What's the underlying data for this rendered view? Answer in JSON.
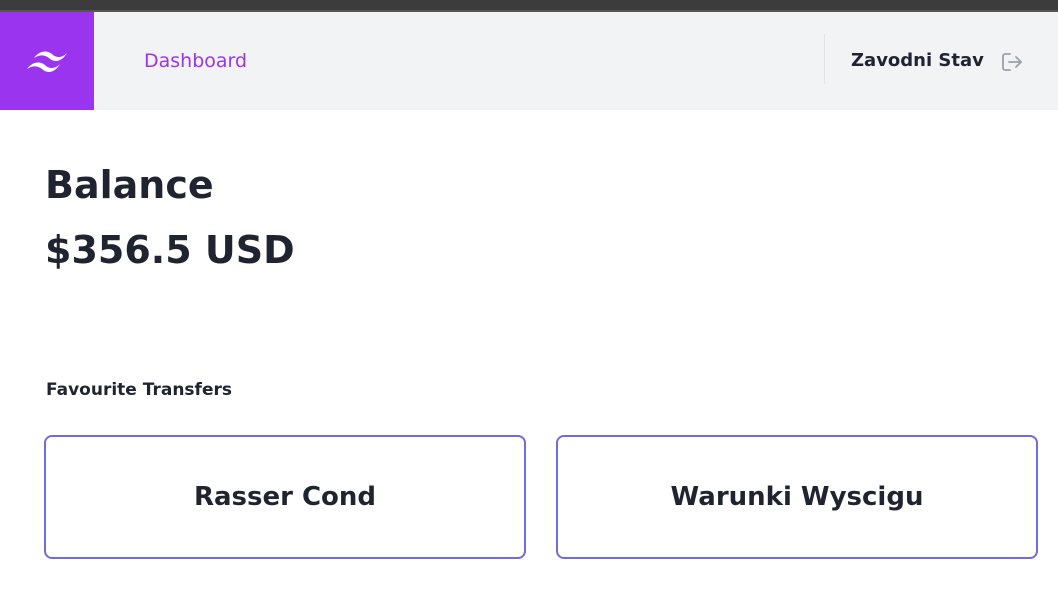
{
  "header": {
    "logo_icon": "tailwind-wave-icon",
    "nav_link": "Dashboard",
    "user_name": "Zavodni Stav",
    "logout_icon": "logout-icon"
  },
  "colors": {
    "brand": "#9b34ee",
    "card_border": "#6f6ae6",
    "navbar_bg": "#f2f3f5",
    "text": "#1f2430"
  },
  "balance": {
    "title": "Balance",
    "amount": "$356.5 USD"
  },
  "favourites": {
    "label": "Favourite Transfers",
    "items": [
      {
        "label": "Rasser Cond"
      },
      {
        "label": "Warunki Wyscigu"
      }
    ]
  }
}
